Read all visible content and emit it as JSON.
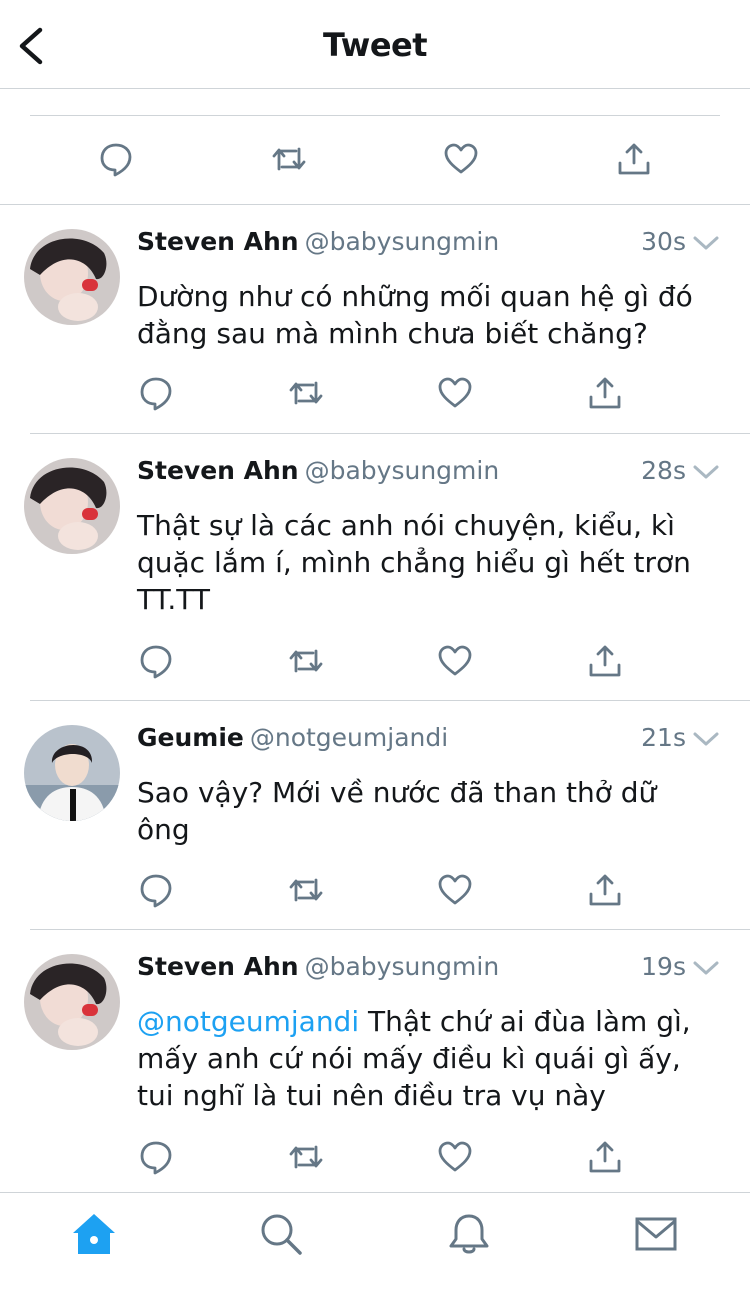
{
  "header": {
    "title": "Tweet",
    "back_icon": "chevron-left-icon"
  },
  "colors": {
    "accent": "#1da1f2",
    "icon_gray": "#657786",
    "divider": "#cfd4d8",
    "text": "#14171a"
  },
  "parent_actions": [
    "reply-icon",
    "retweet-icon",
    "like-icon",
    "share-icon"
  ],
  "tweets": [
    {
      "name": "Steven Ahn",
      "handle": "@babysungmin",
      "time": "30s",
      "text_lines": [
        "Dường như có những mối quan hệ gì đó",
        "đằng sau mà mình chưa biết chăng?"
      ]
    },
    {
      "name": "Steven Ahn",
      "handle": "@babysungmin",
      "time": "28s",
      "text_lines": [
        "Thật sự là các anh nói chuyện, kiểu, kì",
        "quặc lắm í, mình chẳng hiểu gì hết trơn",
        "TT.TT"
      ]
    },
    {
      "name": "Geumie",
      "handle": "@notgeumjandi",
      "time": "21s",
      "text_lines": [
        "Sao vậy? Mới về nước đã than thở dữ",
        "ông"
      ]
    },
    {
      "name": "Steven Ahn",
      "handle": "@babysungmin",
      "time": "19s",
      "mention": "@notgeumjandi",
      "text_lines": [
        " Thật chứ ai đùa làm gì,",
        "mấy anh cứ nói mấy điều kì quái gì ấy,",
        "tui nghĩ là tui nên điều tra vụ này"
      ]
    }
  ],
  "tabbar": {
    "items": [
      "home-icon",
      "search-icon",
      "notifications-icon",
      "messages-icon"
    ],
    "active": "home-icon"
  }
}
